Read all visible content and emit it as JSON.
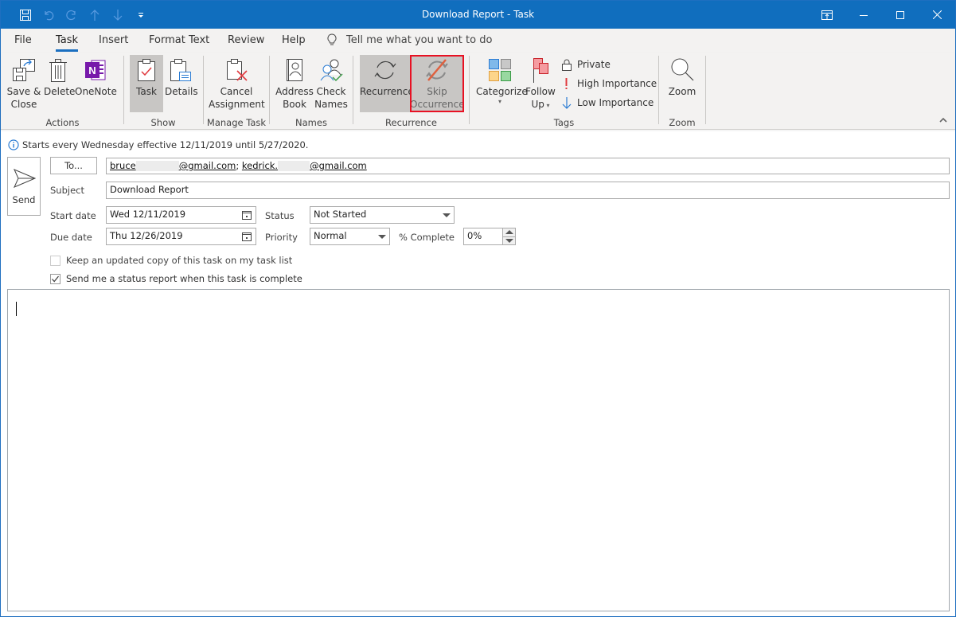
{
  "window": {
    "title": "Download Report  -  Task",
    "controls": [
      "restore-ribbon",
      "minimize",
      "maximize",
      "close"
    ]
  },
  "quick_access": [
    "save",
    "undo",
    "redo",
    "previous-item",
    "next-item",
    "customize"
  ],
  "tabs": [
    {
      "label": "File"
    },
    {
      "label": "Task",
      "active": true
    },
    {
      "label": "Insert"
    },
    {
      "label": "Format Text"
    },
    {
      "label": "Review"
    },
    {
      "label": "Help"
    }
  ],
  "tell_me": "Tell me what you want to do",
  "ribbon": {
    "actions": {
      "label": "Actions",
      "save_close_1": "Save &",
      "save_close_2": "Close",
      "delete": "Delete",
      "onenote": "OneNote"
    },
    "show": {
      "label": "Show",
      "task": "Task",
      "details": "Details"
    },
    "manage_task": {
      "label": "Manage Task",
      "cancel_1": "Cancel",
      "cancel_2": "Assignment"
    },
    "names": {
      "label": "Names",
      "address_1": "Address",
      "address_2": "Book",
      "check_1": "Check",
      "check_2": "Names"
    },
    "recurrence": {
      "label": "Recurrence",
      "recurrence": "Recurrence",
      "skip_1": "Skip",
      "skip_2": "Occurrence"
    },
    "tags": {
      "label": "Tags",
      "categorize": "Categorize",
      "follow_1": "Follow",
      "follow_2": "Up",
      "private": "Private",
      "high": "High Importance",
      "low": "Low Importance"
    },
    "zoom": {
      "label": "Zoom",
      "zoom": "Zoom"
    }
  },
  "info_bar": "Starts every Wednesday effective 12/11/2019 until 5/27/2020.",
  "form": {
    "send": "Send",
    "to_button": "To...",
    "recipients": [
      {
        "prefix": "bruce",
        "domain": "@gmail.com"
      },
      {
        "prefix": "kedrick.",
        "domain": "@gmail.com"
      }
    ],
    "separator": ";",
    "subject_label": "Subject",
    "subject": "Download Report",
    "start_label": "Start date",
    "start_date": "Wed 12/11/2019",
    "due_label": "Due date",
    "due_date": "Thu 12/26/2019",
    "status_label": "Status",
    "status": "Not Started",
    "priority_label": "Priority",
    "priority": "Normal",
    "complete_label": "% Complete",
    "complete": "0%",
    "keep_copy": {
      "label": "Keep an updated copy of this task on my task list",
      "checked": false,
      "disabled": true
    },
    "status_report": {
      "label": "Send me a status report when this task is complete",
      "checked": true
    }
  },
  "colors": {
    "titlebar": "#106ebe",
    "ribbon_bg": "#f3f2f1",
    "selected_btn": "#c8c6c4",
    "highlight": "#e81123"
  }
}
